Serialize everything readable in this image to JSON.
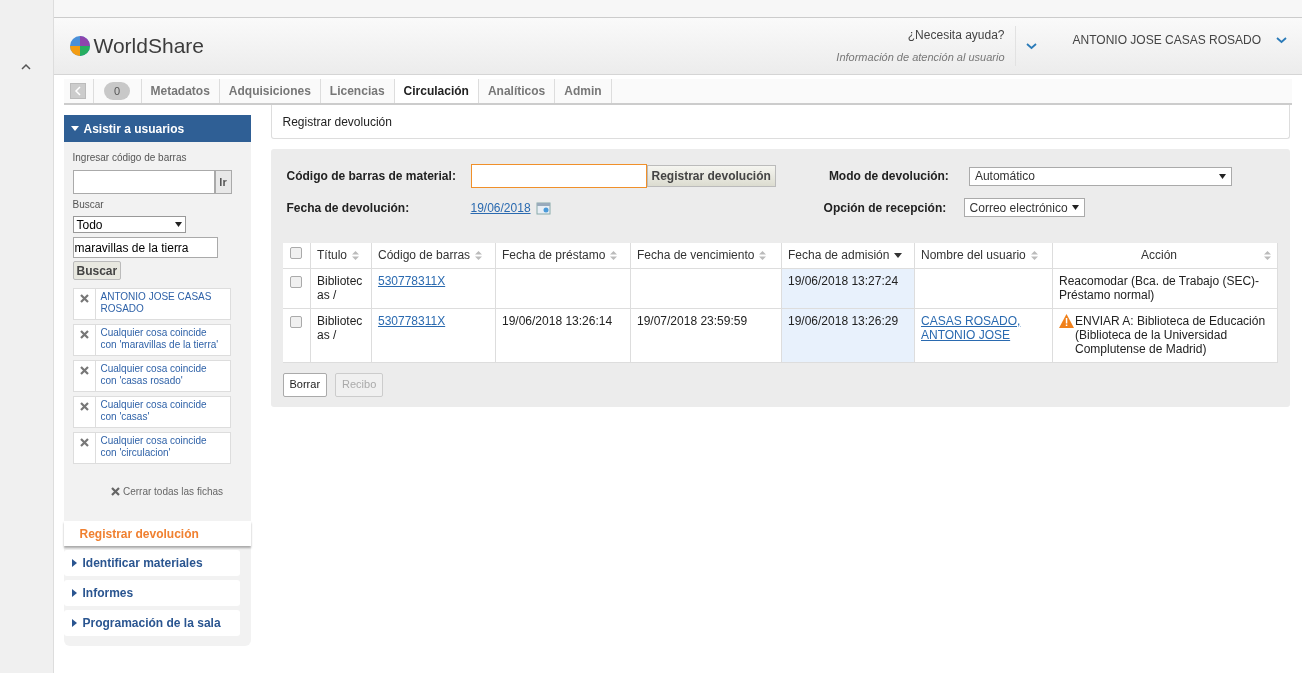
{
  "header": {
    "logo_text": "WorldShare",
    "help_title": "¿Necesita ayuda?",
    "help_subtitle": "Información de atención al usuario",
    "user_name": "ANTONIO JOSE CASAS ROSADO"
  },
  "nav": {
    "badge": "0",
    "tabs": [
      {
        "label": "Metadatos",
        "selected": false
      },
      {
        "label": "Adquisiciones",
        "selected": false
      },
      {
        "label": "Licencias",
        "selected": false
      },
      {
        "label": "Circulación",
        "selected": true
      },
      {
        "label": "Analíticos",
        "selected": false
      },
      {
        "label": "Admin",
        "selected": false
      }
    ]
  },
  "sidebar": {
    "panel_title": "Asistir a usuarios",
    "expanded": true,
    "barcode_label": "Ingresar código de barras",
    "go_button": "Ir",
    "search_label": "Buscar",
    "search_scope": "Todo",
    "search_value": "maravillas de la tierra",
    "search_button": "Buscar",
    "chips": [
      {
        "text": "ANTONIO JOSE CASAS ROSADO"
      },
      {
        "text": "Cualquier cosa coincide con 'maravillas de la tierra'"
      },
      {
        "text": "Cualquier cosa coincide con 'casas rosado'"
      },
      {
        "text": "Cualquier cosa coincide con 'casas'"
      },
      {
        "text": "Cualquier cosa coincide con 'circulacion'"
      }
    ],
    "close_all": "Cerrar todas las fichas",
    "items": [
      {
        "label": "Registrar devolución",
        "selected": true
      },
      {
        "label": "Identificar materiales",
        "selected": false
      },
      {
        "label": "Informes",
        "selected": false
      },
      {
        "label": "Programación de la sala",
        "selected": false
      }
    ]
  },
  "page_title": "Registrar devolución",
  "form": {
    "barcode_label": "Código de barras de material:",
    "submit_button": "Registrar devolución",
    "date_label": "Fecha de devolución:",
    "date_value": "19/06/2018",
    "mode_label": "Modo de devolución:",
    "mode_value": "Automático",
    "receipt_label": "Opción de recepción:",
    "receipt_value": "Correo electrónico"
  },
  "table": {
    "all_checked": false,
    "columns": [
      {
        "label": "Título",
        "sorted": false
      },
      {
        "label": "Código de barras",
        "sorted": false
      },
      {
        "label": "Fecha de préstamo",
        "sorted": false
      },
      {
        "label": "Fecha de vencimiento",
        "sorted": false
      },
      {
        "label": "Fecha de admisión",
        "sorted": true
      },
      {
        "label": "Nombre del usuario",
        "sorted": false
      },
      {
        "label": "Acción",
        "sorted": false
      }
    ],
    "rows": [
      {
        "checked": false,
        "warning": false,
        "cells": [
          "Bibliotec as /",
          "530778311X",
          "",
          "",
          "19/06/2018 13:27:24",
          "",
          "Reacomodar (Bca. de Trabajo (SEC)-Préstamo normal)"
        ]
      },
      {
        "checked": false,
        "warning": true,
        "cells": [
          "Bibliotec as /",
          "530778311X",
          "19/06/2018 13:26:14",
          "19/07/2018 23:59:59",
          "19/06/2018 13:26:29",
          "CASAS ROSADO, ANTONIO JOSE",
          "ENVIAR A: Biblioteca de Educación (Biblioteca de la Universidad Complutense de Madrid)"
        ]
      }
    ],
    "buttons": [
      {
        "label": "Borrar",
        "disabled": false
      },
      {
        "label": "Recibo",
        "disabled": true
      }
    ]
  }
}
